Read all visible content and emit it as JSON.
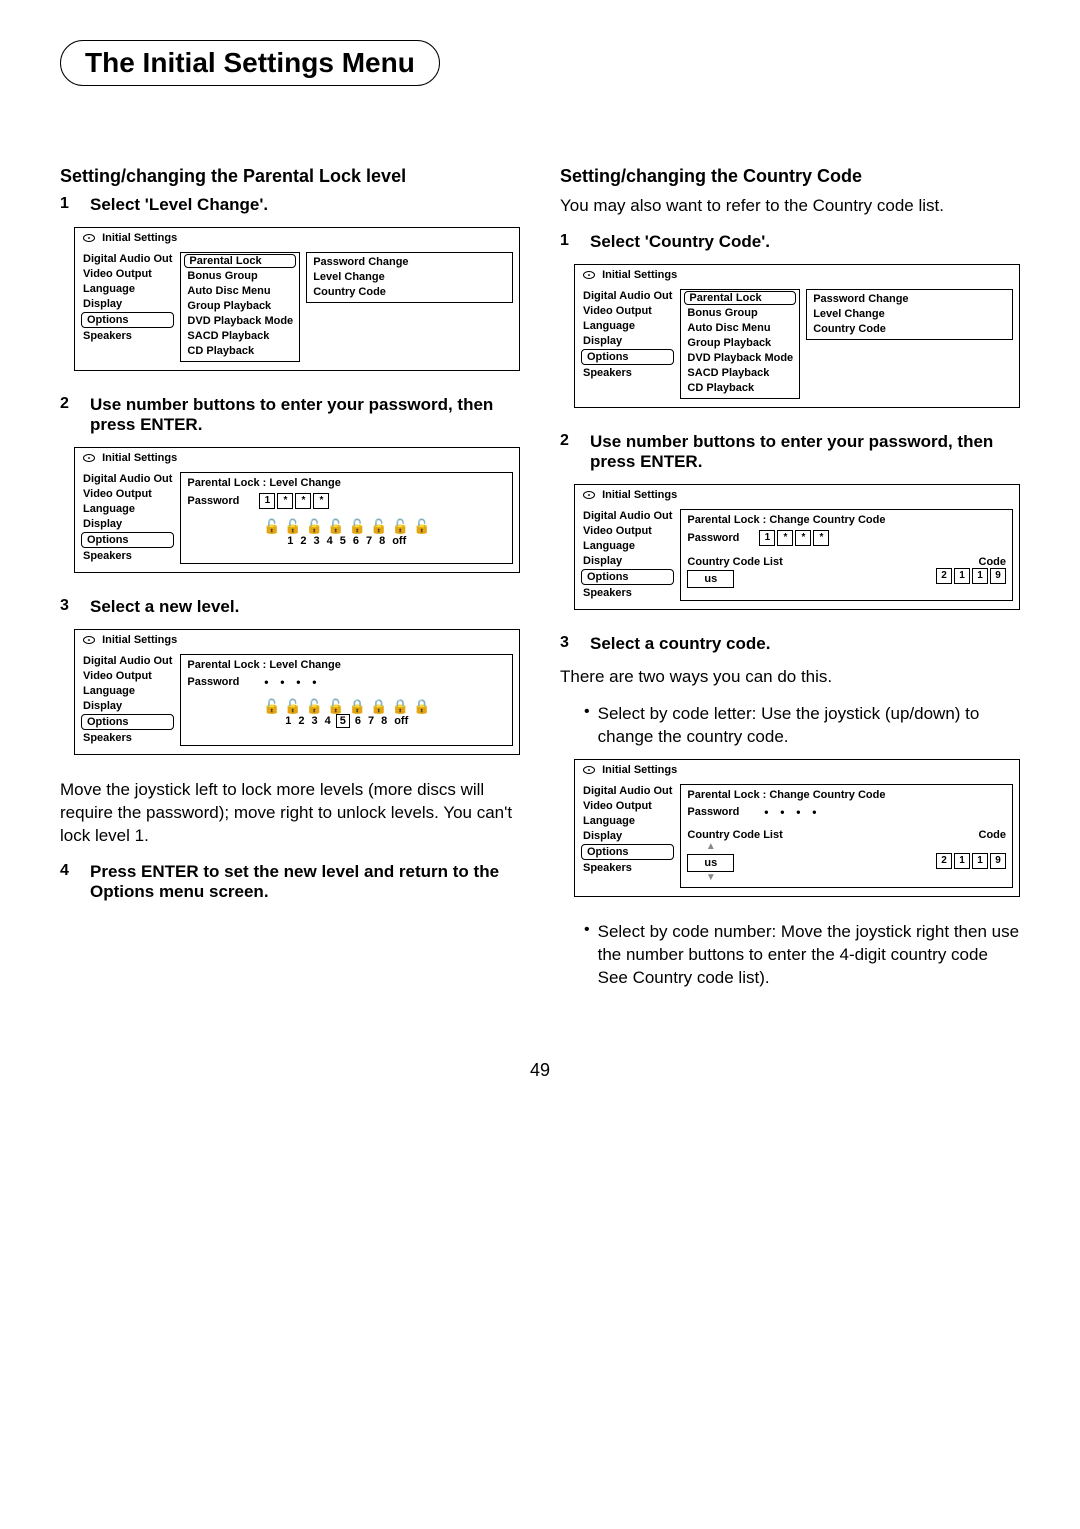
{
  "chapter_title": "The Initial Settings Menu",
  "left": {
    "sec1_heading": "Setting/changing the Parental Lock level",
    "step1_num": "1",
    "step1_text": "Select 'Level Change'.",
    "osd1_title": "Initial Settings",
    "osd1_left": [
      "Digital Audio Out",
      "Video Output",
      "Language",
      "Display",
      "Options",
      "Speakers"
    ],
    "osd1_mid_boxed": "Parental Lock",
    "osd1_mid": [
      "Bonus Group",
      "Auto Disc Menu",
      "Group Playback",
      "DVD Playback Mode",
      "SACD Playback",
      "CD Playback"
    ],
    "osd1_right": [
      "Password Change",
      "Level Change",
      "Country Code"
    ],
    "step2_num": "2",
    "step2_text": "Use number buttons to enter your password, then press ENTER.",
    "osd2_title": "Initial Settings",
    "osd2_left": [
      "Digital Audio Out",
      "Video Output",
      "Language",
      "Display",
      "Options",
      "Speakers"
    ],
    "osd2_breadcrumb": "Parental Lock : Level Change",
    "osd2_pw_label": "Password",
    "osd2_pw_first": "1",
    "osd2_nums": [
      "1",
      "2",
      "3",
      "4",
      "5",
      "6",
      "7",
      "8",
      "off"
    ],
    "step3_num": "3",
    "step3_text": "Select a new level.",
    "osd3_title": "Initial Settings",
    "osd3_left": [
      "Digital Audio Out",
      "Video Output",
      "Language",
      "Display",
      "Options",
      "Speakers"
    ],
    "osd3_breadcrumb": "Parental Lock : Level Change",
    "osd3_pw_label": "Password",
    "osd3_nums": [
      "1",
      "2",
      "3",
      "4",
      "5",
      "6",
      "7",
      "8",
      "off"
    ],
    "osd3_selected": "5",
    "para1": "Move the joystick left to lock more levels (more discs will require the password); move right to unlock levels. You can't lock level 1.",
    "step4_num": "4",
    "step4_text": "Press ENTER to set the new level and return to the Options menu screen."
  },
  "right": {
    "sec1_heading": "Setting/changing the Country Code",
    "para1": "You may also want to refer to the Country code list.",
    "step1_num": "1",
    "step1_text": "Select 'Country Code'.",
    "osd1_title": "Initial Settings",
    "osd1_left": [
      "Digital Audio Out",
      "Video Output",
      "Language",
      "Display",
      "Options",
      "Speakers"
    ],
    "osd1_mid_boxed": "Parental Lock",
    "osd1_mid": [
      "Bonus Group",
      "Auto Disc Menu",
      "Group Playback",
      "DVD Playback Mode",
      "SACD Playback",
      "CD Playback"
    ],
    "osd1_right": [
      "Password Change",
      "Level Change",
      "Country Code"
    ],
    "step2_num": "2",
    "step2_text": "Use number buttons to enter your password, then press ENTER.",
    "osd2_title": "Initial Settings",
    "osd2_left": [
      "Digital Audio Out",
      "Video Output",
      "Language",
      "Display",
      "Options",
      "Speakers"
    ],
    "osd2_breadcrumb": "Parental Lock : Change Country Code",
    "osd2_pw_label": "Password",
    "osd2_pw_first": "1",
    "osd2_ccl_label": "Country Code List",
    "osd2_code_label": "Code",
    "osd2_cc_letter": "us",
    "osd2_cc_num": [
      "2",
      "1",
      "1",
      "9"
    ],
    "step3_num": "3",
    "step3_text": "Select a country code.",
    "para2": "There are two ways you can do this.",
    "bullet1": "Select by code letter: Use the joystick (up/down) to change the country code.",
    "osd3_title": "Initial Settings",
    "osd3_left": [
      "Digital Audio Out",
      "Video Output",
      "Language",
      "Display",
      "Options",
      "Speakers"
    ],
    "osd3_breadcrumb": "Parental Lock : Change Country Code",
    "osd3_pw_label": "Password",
    "osd3_ccl_label": "Country Code List",
    "osd3_code_label": "Code",
    "osd3_cc_letter": "us",
    "osd3_cc_num": [
      "2",
      "1",
      "1",
      "9"
    ],
    "bullet2": "Select by code number: Move the joystick right then use the number buttons to enter the 4-digit country code See Country code list)."
  },
  "page_number": "49"
}
